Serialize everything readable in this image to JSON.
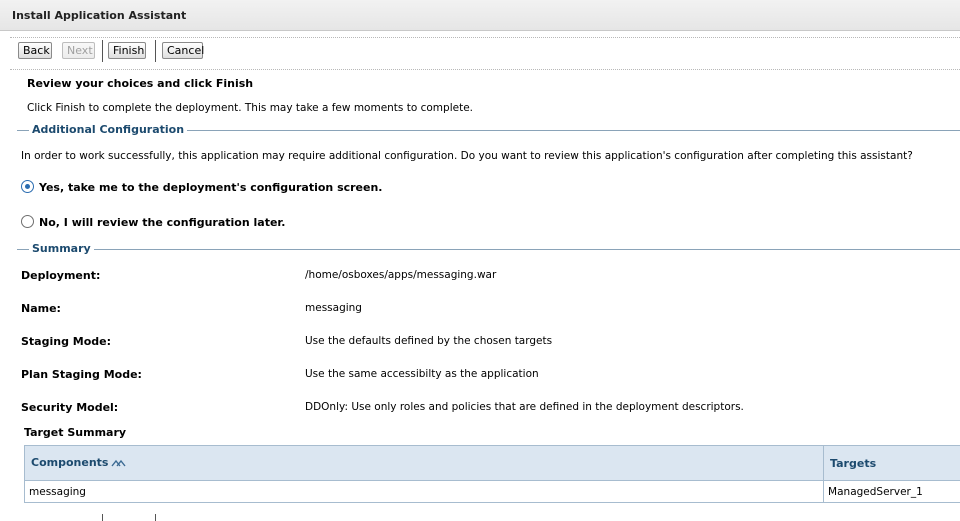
{
  "window": {
    "title": "Install Application Assistant"
  },
  "toolbar": {
    "back": "Back",
    "next": "Next",
    "finish": "Finish",
    "cancel": "Cancel"
  },
  "review": {
    "heading": "Review your choices and click Finish",
    "description": "Click Finish to complete the deployment. This may take a few moments to complete."
  },
  "additional_config": {
    "legend": "Additional Configuration",
    "question": "In order to work successfully, this application may require additional configuration. Do you want to review this application's configuration after completing this assistant?",
    "options": [
      {
        "label": "Yes, take me to the deployment's configuration screen.",
        "selected": true
      },
      {
        "label": "No, I will review the configuration later.",
        "selected": false
      }
    ]
  },
  "summary": {
    "legend": "Summary",
    "fields": [
      {
        "label": "Deployment:",
        "value": "/home/osboxes/apps/messaging.war"
      },
      {
        "label": "Name:",
        "value": "messaging"
      },
      {
        "label": "Staging Mode:",
        "value": "Use the defaults defined by the chosen targets"
      },
      {
        "label": "Plan Staging Mode:",
        "value": "Use the same accessibilty as the application"
      },
      {
        "label": "Security Model:",
        "value": "DDOnly: Use only roles and policies that are defined in the deployment descriptors."
      }
    ]
  },
  "target_summary": {
    "title": "Target Summary",
    "columns": [
      "Components",
      "Targets"
    ],
    "rows": [
      {
        "component": "messaging",
        "target": "ManagedServer_1"
      }
    ]
  },
  "colors": {
    "accent": "#1c4a6e",
    "header_bg": "#dbe6f1",
    "border": "#a7bccf"
  },
  "icons": {
    "sort": "sort-ascending-icon"
  }
}
